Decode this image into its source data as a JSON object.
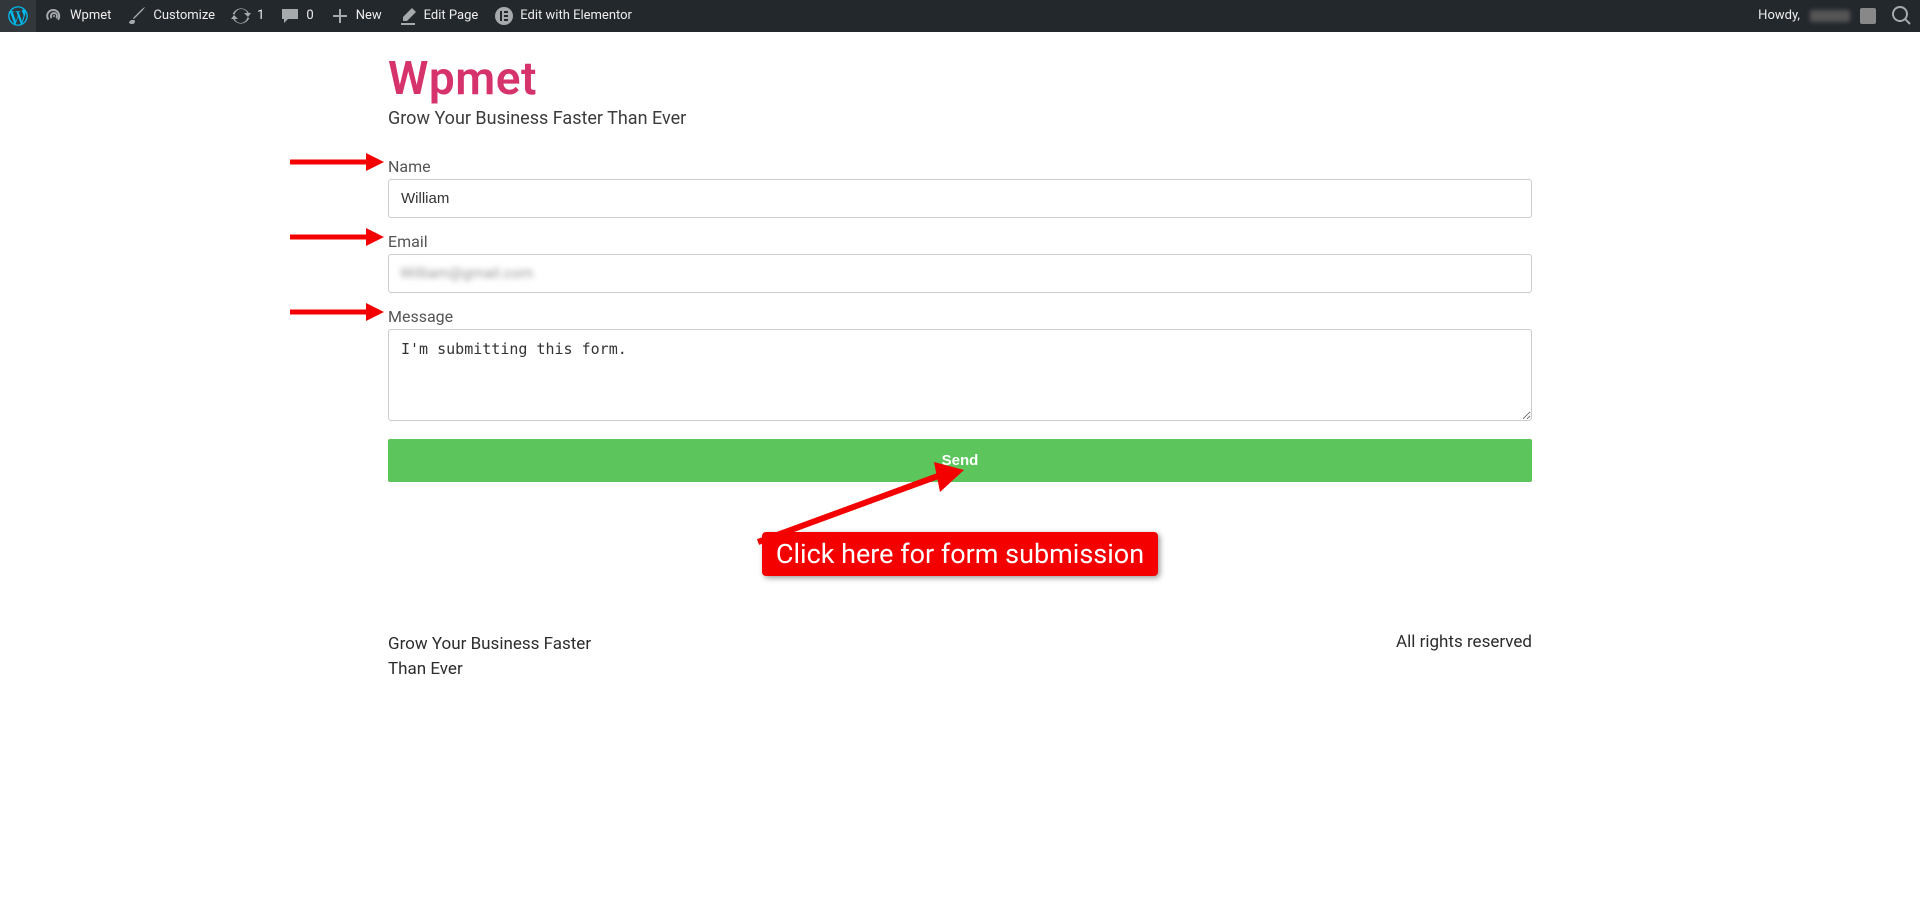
{
  "adminbar": {
    "site_name": "Wpmet",
    "customize": "Customize",
    "updates_count": "1",
    "comments_count": "0",
    "new": "New",
    "edit_page": "Edit Page",
    "edit_elementor": "Edit with Elementor",
    "howdy": "Howdy,"
  },
  "header": {
    "title": "Wpmet",
    "tagline": "Grow Your Business Faster Than Ever"
  },
  "form": {
    "name_label": "Name",
    "name_value": "William",
    "email_label": "Email",
    "email_value": "William@gmail.com",
    "message_label": "Message",
    "message_value": "I'm submitting this form.",
    "send_label": "Send"
  },
  "annotation": {
    "callout": "Click here for form submission"
  },
  "footer": {
    "left": "Grow Your Business Faster Than Ever",
    "right": "All rights reserved"
  }
}
